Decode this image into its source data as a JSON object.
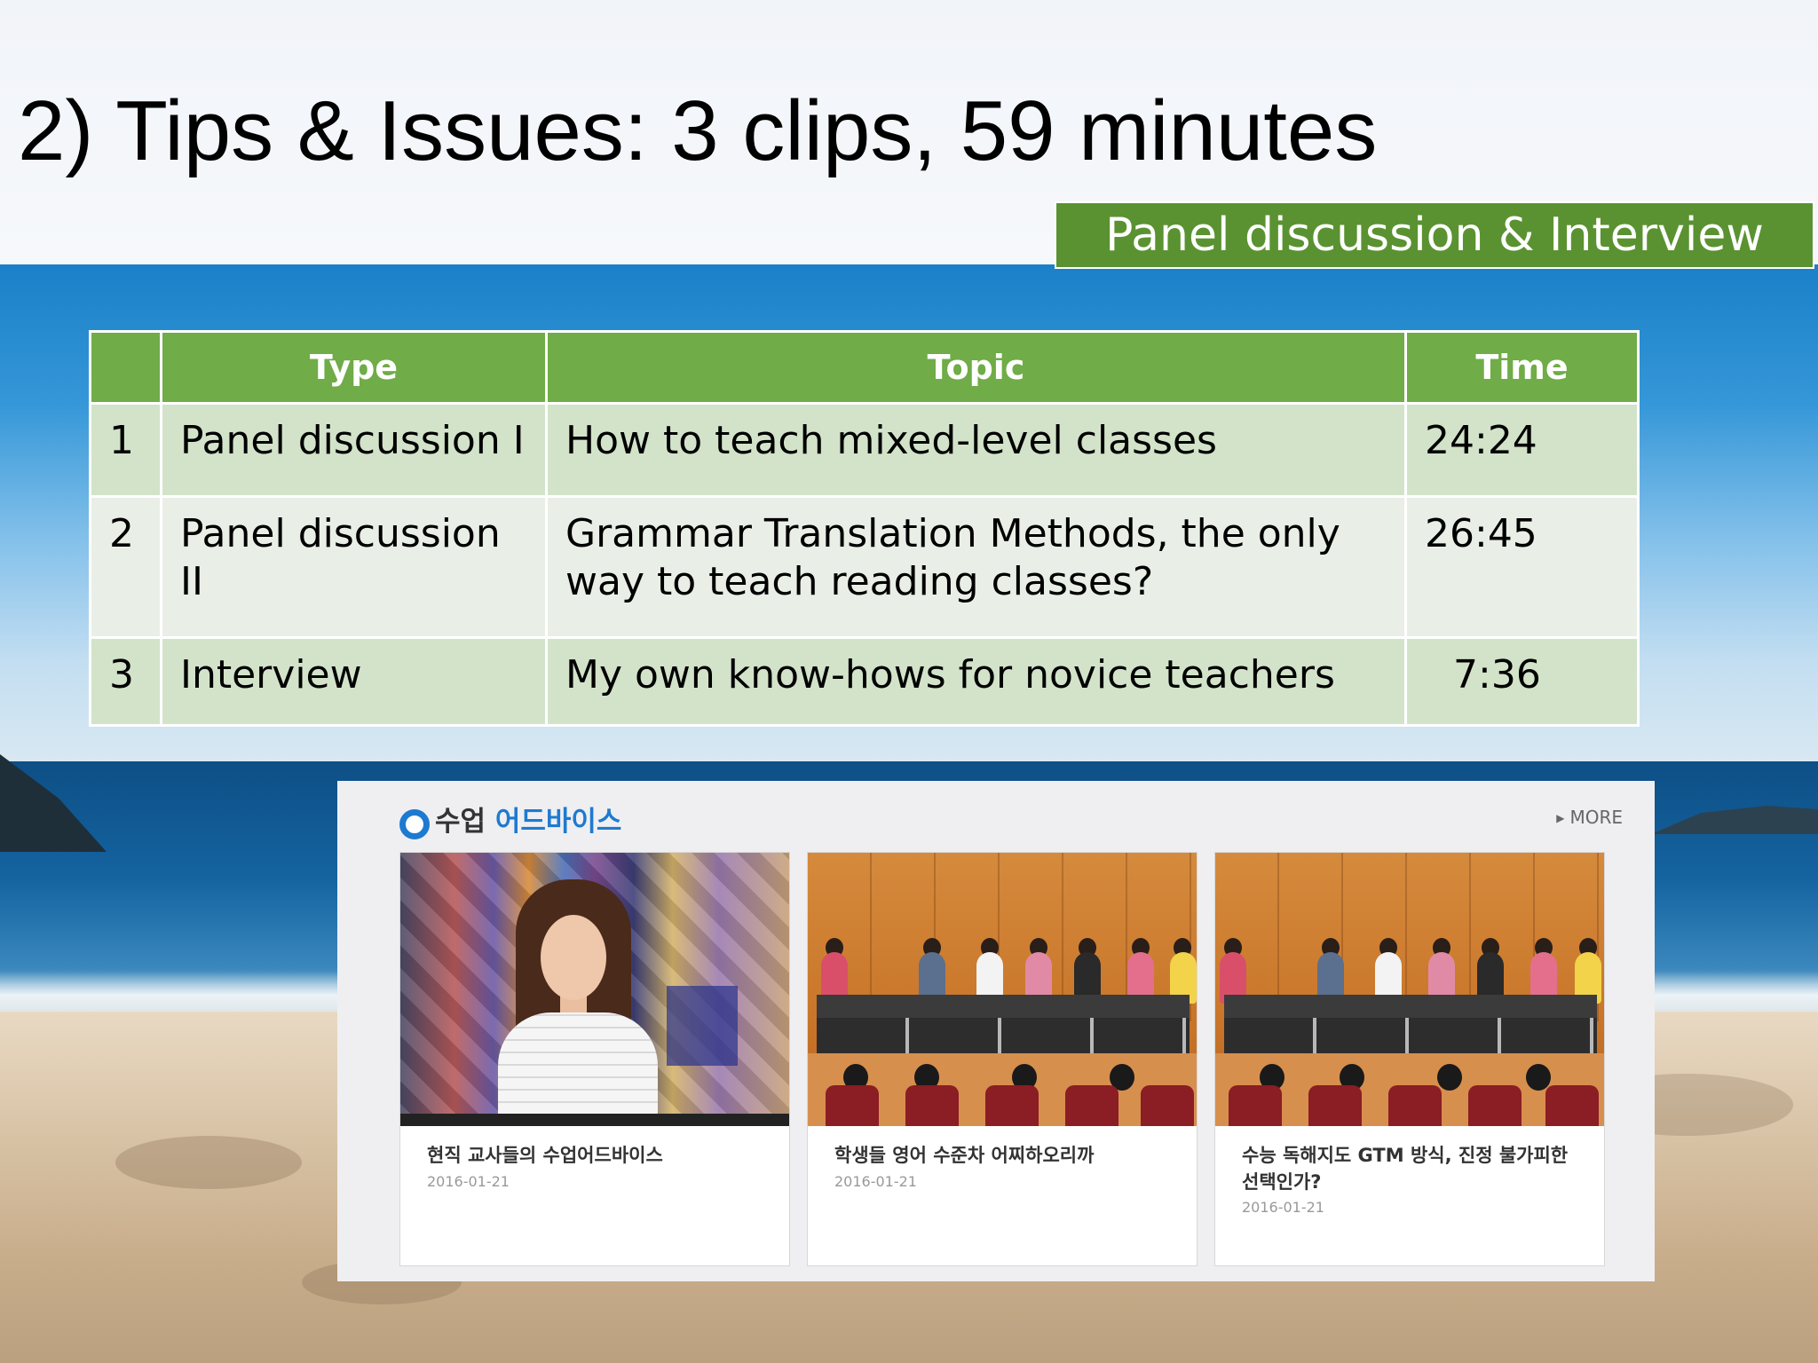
{
  "slide": {
    "title": "2) Tips & Issues: 3 clips, 59 minutes",
    "subtitle": "Panel discussion & Interview"
  },
  "table": {
    "headers": [
      "",
      "Type",
      "Topic",
      "Time"
    ],
    "rows": [
      {
        "num": "1",
        "type": "Panel discussion I",
        "topic": "How to teach mixed-level classes",
        "time": "24:24"
      },
      {
        "num": "2",
        "type": "Panel discussion II",
        "topic": "Grammar Translation Methods, the only way to teach reading classes?",
        "time": "26:45"
      },
      {
        "num": "3",
        "type": "Interview",
        "topic": "My own know-hows for novice teachers",
        "time": "7:36"
      }
    ]
  },
  "website": {
    "section_title_part1": "수업",
    "section_title_part2": "어드바이스",
    "more_label": "MORE",
    "cards": [
      {
        "caption": "현직 교사들의 수업어드바이스",
        "date": "2016-01-21"
      },
      {
        "caption": "학생들 영어 수준차 어찌하오리까",
        "date": "2016-01-21"
      },
      {
        "caption": "수능 독해지도 GTM 방식, 진정 불가피한 선택인가?",
        "date": "2016-01-21"
      }
    ]
  },
  "colors": {
    "accent_green": "#70ac47",
    "subtitle_green": "#5a9231",
    "row_light": "#d2e3c9",
    "row_lighter": "#e9efe6",
    "site_blue": "#1e7ad0"
  }
}
